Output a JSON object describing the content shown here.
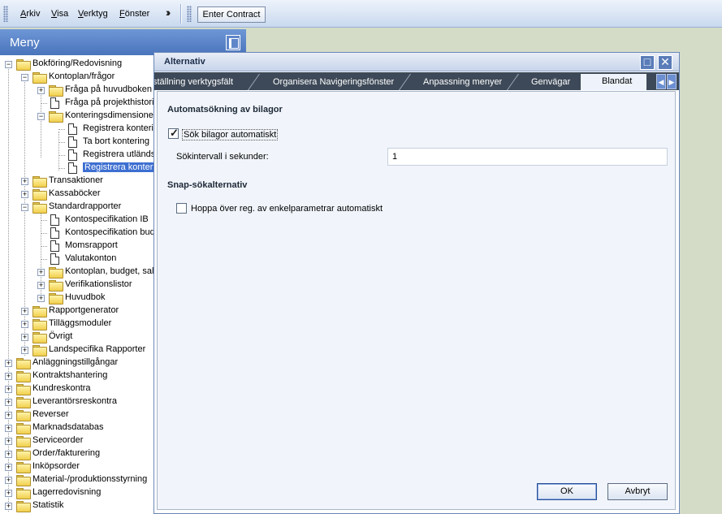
{
  "menubar": {
    "items": [
      "Arkiv",
      "Visa",
      "Verktyg",
      "Fönster"
    ],
    "enter_contract": "Enter Contract"
  },
  "sidebar": {
    "title": "Meny",
    "tree": [
      {
        "label": "Bokföring/Redovisning",
        "level": 0,
        "kind": "folder",
        "expander": "−"
      },
      {
        "label": "Kontoplan/frågor",
        "level": 1,
        "kind": "folder",
        "expander": "−"
      },
      {
        "label": "Fråga på huvudboken",
        "level": 2,
        "kind": "folder",
        "expander": "+"
      },
      {
        "label": "Fråga på projekthistorik",
        "level": 2,
        "kind": "doc"
      },
      {
        "label": "Konteringsdimensioner",
        "level": 2,
        "kind": "folder",
        "expander": "−"
      },
      {
        "label": "Registrera kontering",
        "level": 3,
        "kind": "doc"
      },
      {
        "label": "Ta bort kontering",
        "level": 3,
        "kind": "doc"
      },
      {
        "label": "Registrera utländsk",
        "level": 3,
        "kind": "doc"
      },
      {
        "label": "Registrera kontering",
        "level": 3,
        "kind": "doc",
        "selected": true
      },
      {
        "label": "Transaktioner",
        "level": 1,
        "kind": "folder",
        "expander": "+"
      },
      {
        "label": "Kassaböcker",
        "level": 1,
        "kind": "folder",
        "expander": "+"
      },
      {
        "label": "Standardrapporter",
        "level": 1,
        "kind": "folder",
        "expander": "−"
      },
      {
        "label": "Kontospecifikation IB",
        "level": 2,
        "kind": "doc"
      },
      {
        "label": "Kontospecifikation budget",
        "level": 2,
        "kind": "doc"
      },
      {
        "label": "Momsrapport",
        "level": 2,
        "kind": "doc"
      },
      {
        "label": "Valutakonton",
        "level": 2,
        "kind": "doc"
      },
      {
        "label": "Kontoplan, budget, saldon",
        "level": 2,
        "kind": "folder",
        "expander": "+"
      },
      {
        "label": "Verifikationslistor",
        "level": 2,
        "kind": "folder",
        "expander": "+"
      },
      {
        "label": "Huvudbok",
        "level": 2,
        "kind": "folder",
        "expander": "+"
      },
      {
        "label": "Rapportgenerator",
        "level": 1,
        "kind": "folder",
        "expander": "+"
      },
      {
        "label": "Tilläggsmoduler",
        "level": 1,
        "kind": "folder",
        "expander": "+"
      },
      {
        "label": "Övrigt",
        "level": 1,
        "kind": "folder",
        "expander": "+"
      },
      {
        "label": "Landspecifika Rapporter",
        "level": 1,
        "kind": "folder",
        "expander": "+"
      },
      {
        "label": "Anläggningstillgångar",
        "level": 0,
        "kind": "folder",
        "expander": "+"
      },
      {
        "label": "Kontraktshantering",
        "level": 0,
        "kind": "folder",
        "expander": "+"
      },
      {
        "label": "Kundreskontra",
        "level": 0,
        "kind": "folder",
        "expander": "+"
      },
      {
        "label": "Leverantörsreskontra",
        "level": 0,
        "kind": "folder",
        "expander": "+"
      },
      {
        "label": "Reverser",
        "level": 0,
        "kind": "folder",
        "expander": "+"
      },
      {
        "label": "Marknadsdatabas",
        "level": 0,
        "kind": "folder",
        "expander": "+"
      },
      {
        "label": "Serviceorder",
        "level": 0,
        "kind": "folder",
        "expander": "+"
      },
      {
        "label": "Order/fakturering",
        "level": 0,
        "kind": "folder",
        "expander": "+"
      },
      {
        "label": "Inköpsorder",
        "level": 0,
        "kind": "folder",
        "expander": "+"
      },
      {
        "label": "Material-/produktionsstyrning",
        "level": 0,
        "kind": "folder",
        "expander": "+"
      },
      {
        "label": "Lagerredovisning",
        "level": 0,
        "kind": "folder",
        "expander": "+"
      },
      {
        "label": "Statistik",
        "level": 0,
        "kind": "folder",
        "expander": "+"
      }
    ]
  },
  "dialog": {
    "title": "Alternativ",
    "tabs": [
      "ställning verktygsfält",
      "Organisera Navigeringsfönster",
      "Anpassning menyer",
      "Genvägar",
      "Blandat"
    ],
    "active_tab": "Blandat",
    "section1": {
      "heading": "Automatsökning av bilagor",
      "checkbox_label": "Sök bilagor automatiskt",
      "checkbox_checked": true,
      "interval_label": "Sökintervall i sekunder:",
      "interval_value": "1"
    },
    "section2": {
      "heading": "Snap-sökalternativ",
      "checkbox_label": "Hoppa över reg. av enkelparametrar automatiskt",
      "checkbox_checked": false
    },
    "ok": "OK",
    "cancel": "Avbryt"
  },
  "colors": {
    "header_blue": "#5a80c6",
    "tab_bar": "#3d4958",
    "selection": "#3d6fd1"
  }
}
